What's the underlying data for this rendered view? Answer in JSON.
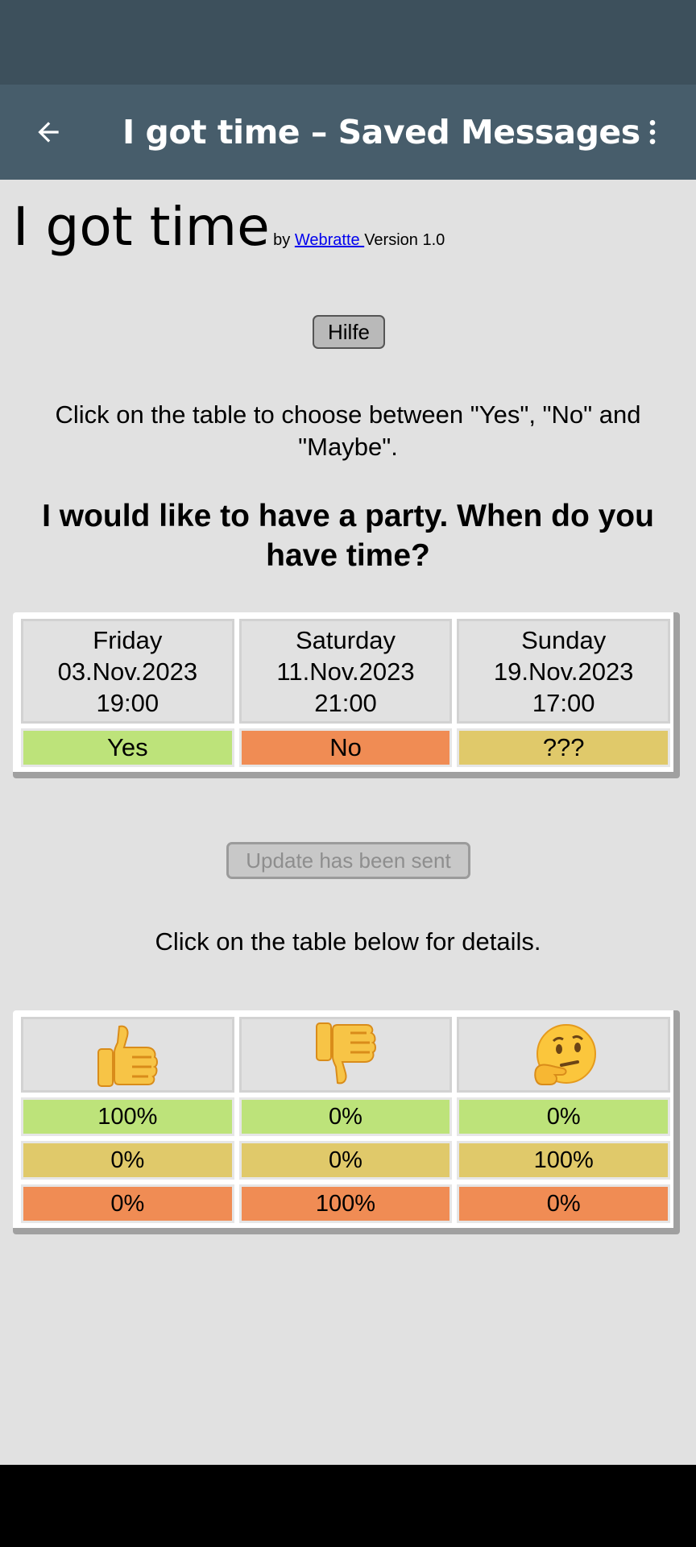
{
  "appbar": {
    "title": "I got time – Saved Messages",
    "back_icon": "arrow-left-icon",
    "menu_icon": "more-vert-icon"
  },
  "header": {
    "app_name": "I got time",
    "by": "by ",
    "author": "Webratte ",
    "version": "Version 1.0"
  },
  "help_button": "Hilfe",
  "instruction": "Click on the table to choose between \"Yes\", \"No\" and \"Maybe\".",
  "question": "I would like to have a party. When do you have time?",
  "schedule": {
    "dates": [
      {
        "day": "Friday",
        "date": "03.Nov.2023",
        "time": "19:00",
        "answer": "Yes"
      },
      {
        "day": "Saturday",
        "date": "11.Nov.2023",
        "time": "21:00",
        "answer": "No"
      },
      {
        "day": "Sunday",
        "date": "19.Nov.2023",
        "time": "17:00",
        "answer": "???"
      }
    ]
  },
  "update_button": "Update has been sent",
  "details_hint": "Click on the table below for details.",
  "summary": {
    "icons": [
      "thumbs-up-icon",
      "thumbs-down-icon",
      "thinking-face-icon"
    ],
    "rows": [
      [
        "100%",
        "0%",
        "0%"
      ],
      [
        "0%",
        "0%",
        "100%"
      ],
      [
        "0%",
        "100%",
        "0%"
      ]
    ]
  },
  "colors": {
    "yes": "#bde37a",
    "no": "#f08c54",
    "maybe": "#e0c96a",
    "statusbar": "#3d505c",
    "appbar": "#475d6b",
    "background": "#e1e1e1"
  }
}
